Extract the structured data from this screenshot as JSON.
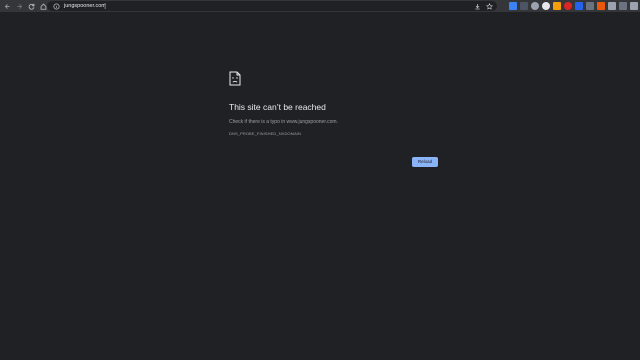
{
  "toolbar": {
    "back_icon": "arrow-left-icon",
    "forward_icon": "arrow-right-icon",
    "reload_icon": "reload-icon",
    "home_icon": "home-icon",
    "url": "jungspooner.com",
    "site_info_icon": "site-info-icon",
    "download_icon": "download-icon",
    "bookmark_icon": "star-icon",
    "extensions": [
      "extension-1",
      "extension-2",
      "extension-3",
      "extension-4",
      "extension-5",
      "extension-6",
      "extension-7",
      "extension-8",
      "extension-9",
      "extension-10",
      "extension-11",
      "extension-12",
      "extension-13"
    ]
  },
  "error": {
    "icon": "sad-page-icon",
    "title": "This site can’t be reached",
    "description": "Check if there is a typo in www.jungspooner.com.",
    "code": "DNS_PROBE_FINISHED_NXDOMAIN",
    "reload_label": "Reload"
  },
  "colors": {
    "background": "#202124",
    "toolbar": "#35363a",
    "accent": "#8ab4f8"
  }
}
